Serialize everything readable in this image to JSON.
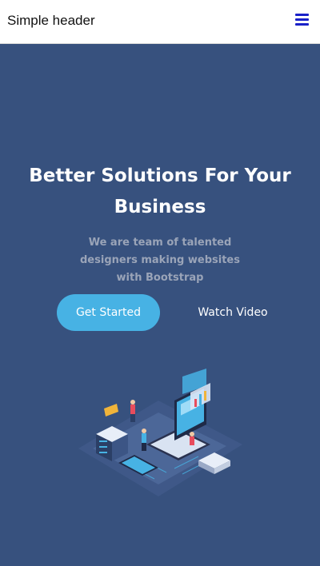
{
  "header": {
    "brand": "Simple header",
    "menu_icon": "hamburger-menu-icon"
  },
  "hero": {
    "title": "Better Solutions For Your Business",
    "subtitle": "We are team of talented designers making websites with Bootstrap",
    "primary_button": "Get Started",
    "secondary_button": "Watch Video",
    "illustration": "isometric-laptop-servers-illustration"
  },
  "colors": {
    "hero_bg": "#37517e",
    "accent": "#47b2e4",
    "menu_icon": "#1a21c8"
  }
}
